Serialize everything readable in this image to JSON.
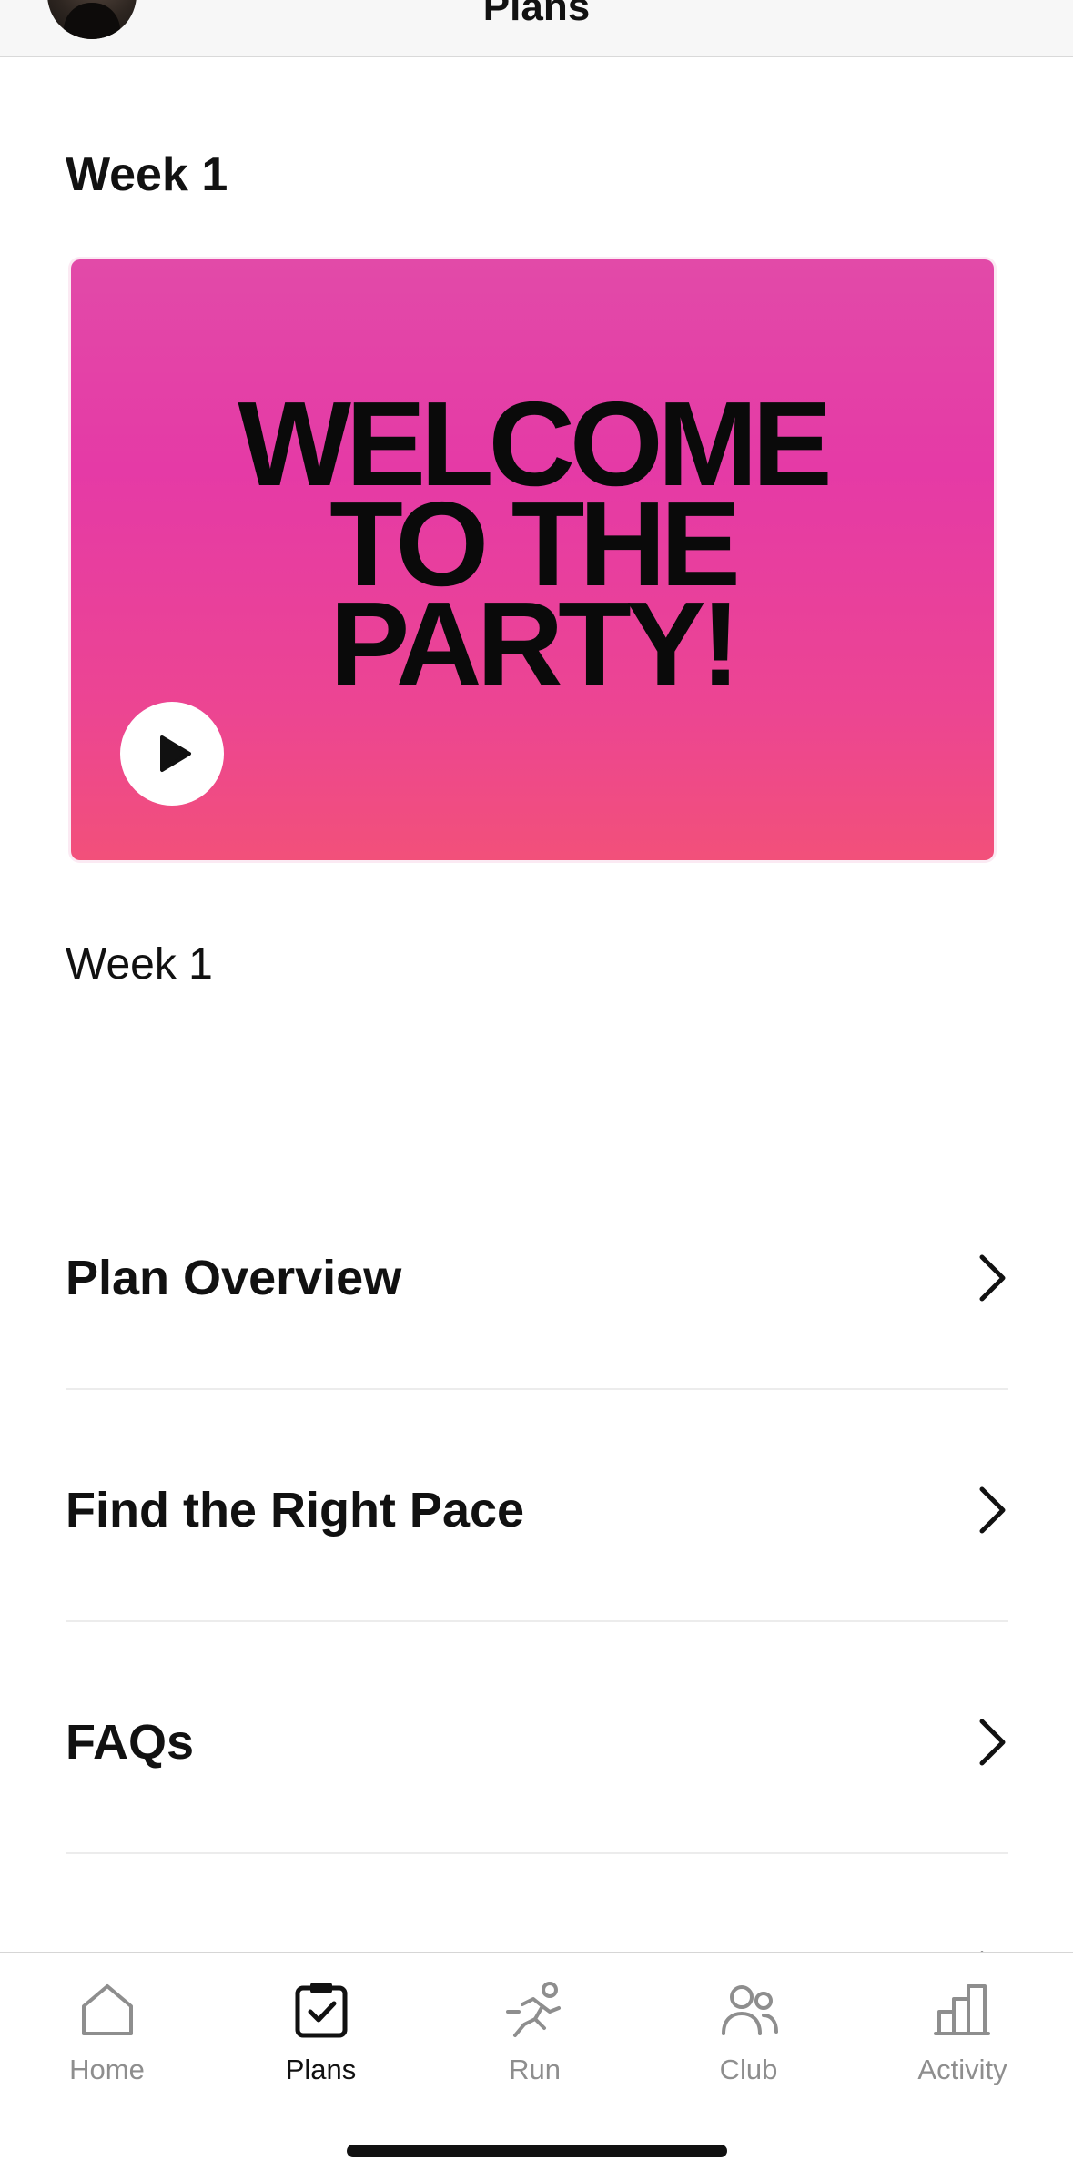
{
  "header": {
    "title": "Plans"
  },
  "section": {
    "title": "Week 1"
  },
  "video": {
    "lines": [
      "WELCOME",
      "TO THE",
      "PARTY!"
    ],
    "caption": "Week 1",
    "colors": {
      "gradient_top": "#e24aa8",
      "gradient_bottom": "#f2507a"
    }
  },
  "list": {
    "items": [
      {
        "label": "Plan Overview"
      },
      {
        "label": "Find the Right Pace"
      },
      {
        "label": "FAQs"
      }
    ]
  },
  "tabbar": {
    "active": "Plans",
    "tabs": [
      {
        "label": "Home",
        "icon": "home-icon"
      },
      {
        "label": "Plans",
        "icon": "clipboard-check-icon"
      },
      {
        "label": "Run",
        "icon": "runner-icon"
      },
      {
        "label": "Club",
        "icon": "people-icon"
      },
      {
        "label": "Activity",
        "icon": "bar-chart-icon"
      }
    ]
  }
}
